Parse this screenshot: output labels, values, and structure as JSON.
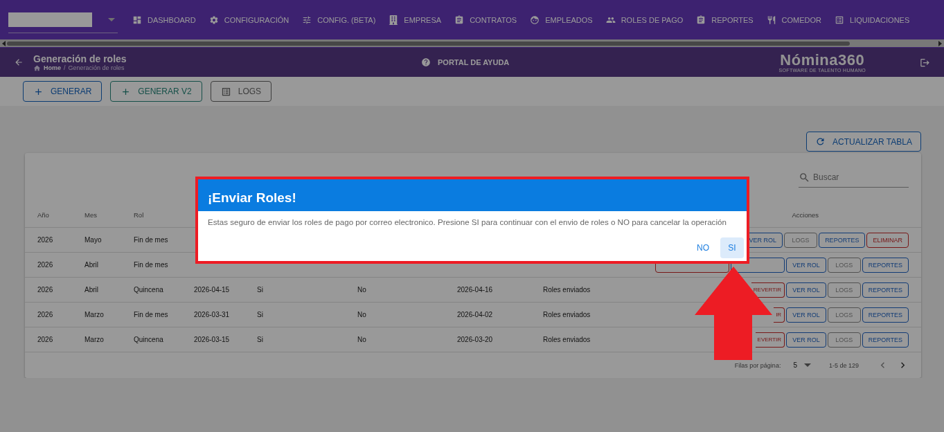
{
  "nav": {
    "items": [
      {
        "label": "DASHBOARD"
      },
      {
        "label": "CONFIGURACIÓN"
      },
      {
        "label": "CONFIG. (BETA)"
      },
      {
        "label": "EMPRESA"
      },
      {
        "label": "CONTRATOS"
      },
      {
        "label": "EMPLEADOS"
      },
      {
        "label": "ROLES DE PAGO"
      },
      {
        "label": "REPORTES"
      },
      {
        "label": "COMEDOR"
      },
      {
        "label": "LIQUIDACIONES"
      }
    ]
  },
  "header": {
    "title": "Generación de roles",
    "breadcrumb": [
      "Home",
      "Generación de roles"
    ],
    "breadcrumb_separator": "/",
    "help": "PORTAL DE AYUDA",
    "logo": {
      "name": "Nómina360",
      "tagline": "SOFTWARE DE TALENTO HUMANO"
    }
  },
  "toolbar": {
    "buttons": [
      {
        "label": "GENERAR",
        "kind": "primary"
      },
      {
        "label": "GENERAR V2",
        "kind": "teal"
      },
      {
        "label": "LOGS",
        "kind": "neutral"
      }
    ]
  },
  "refresh_button": "ACTUALIZAR TABLA",
  "table": {
    "search": {
      "placeholder": "Buscar"
    },
    "columns": [
      "Año",
      "Mes",
      "Rol"
    ],
    "actions_column": "Acciones",
    "rows": [
      {
        "cells": [
          "2026",
          "Mayo",
          "Fin de mes"
        ],
        "actions": [
          {
            "label": "VER ROL",
            "kind": "blue"
          },
          {
            "label": "LOGS",
            "kind": "gray"
          },
          {
            "label": "REPORTES",
            "kind": "blue"
          },
          {
            "label": "ELIMINAR",
            "kind": "red"
          }
        ]
      },
      {
        "cells": [
          "2026",
          "Abril",
          "Fin de mes"
        ],
        "actions": [
          {
            "kind": "red"
          },
          {
            "kind": "blue"
          },
          {
            "label": "VER ROL",
            "kind": "blue"
          },
          {
            "label": "LOGS",
            "kind": "gray"
          },
          {
            "label": "REPORTES",
            "kind": "blue"
          }
        ]
      },
      {
        "cells": [
          "2026",
          "Abril",
          "Quincena",
          "2026-04-15",
          "Si",
          "No",
          "2026-04-16",
          "Roles enviados"
        ],
        "actions": [
          {
            "label": "REVERTIR",
            "kind": "revert"
          },
          {
            "label": "VER ROL",
            "kind": "blue"
          },
          {
            "label": "LOGS",
            "kind": "gray"
          },
          {
            "label": "REPORTES",
            "kind": "blue"
          }
        ]
      },
      {
        "cells": [
          "2026",
          "Marzo",
          "Fin de mes",
          "2026-03-31",
          "Si",
          "No",
          "2026-04-02",
          "Roles enviados"
        ],
        "actions": [
          {
            "label": "IR",
            "kind": "revert"
          },
          {
            "label": "VER ROL",
            "kind": "blue"
          },
          {
            "label": "LOGS",
            "kind": "gray"
          },
          {
            "label": "REPORTES",
            "kind": "blue"
          }
        ]
      },
      {
        "cells": [
          "2026",
          "Marzo",
          "Quincena",
          "2026-03-15",
          "Si",
          "No",
          "2026-03-20",
          "Roles enviados"
        ],
        "actions": [
          {
            "label": "EVERTIR",
            "kind": "revert"
          },
          {
            "label": "VER ROL",
            "kind": "blue"
          },
          {
            "label": "LOGS",
            "kind": "gray"
          },
          {
            "label": "REPORTES",
            "kind": "blue"
          }
        ]
      }
    ]
  },
  "pagination": {
    "rows_per_page_label": "Filas por página:",
    "rows_per_page": "5",
    "range": "1-5 de 129"
  },
  "dialog": {
    "title": "¡Enviar Roles!",
    "message": "Estas seguro de enviar los roles de pago por correo electronico. Presione SI para continuar con el envio de roles o NO para cancelar la operación",
    "buttons": [
      {
        "label": "NO",
        "selected": false
      },
      {
        "label": "SI",
        "selected": true
      }
    ]
  }
}
